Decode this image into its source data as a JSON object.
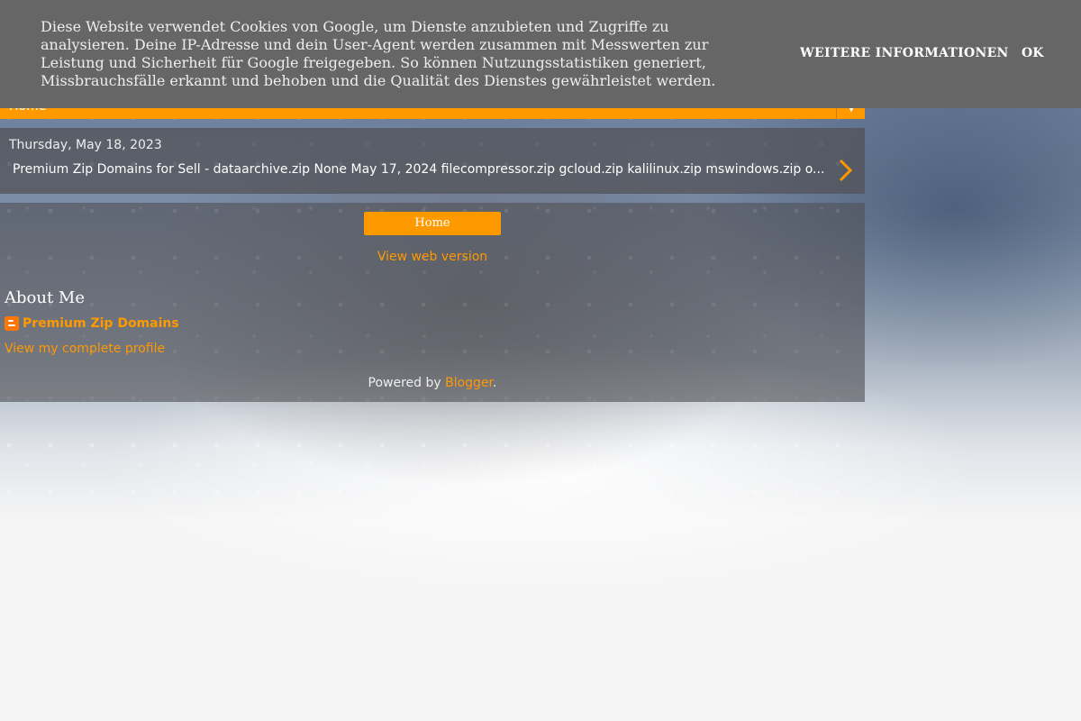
{
  "cookie_banner": {
    "text": "Diese Website verwendet Cookies von Google, um Dienste anzubieten und Zugriffe zu analysieren. Deine IP-Adresse und dein User-Agent werden zusammen mit Messwerten zur Leistung und Sicherheit für Google freigegeben. So können Nutzungsstatistiken generiert, Missbrauchsfälle erkannt und behoben und die Qualität des Dienstes gewährleistet werden.",
    "more_info_label": "WEITERE INFORMATIONEN",
    "ok_label": "OK"
  },
  "nav": {
    "selected": "Home",
    "arrow_icon": "triangle-down-icon"
  },
  "post": {
    "date": "Thursday, May 18, 2023",
    "snippet": "Premium Zip Domains for Sell - dataarchive.zip None May 17, 2024 filecompressor.zip gcloud.zip kalilinux.zip mswindows.zip o...",
    "arrow_icon": "chevron-right-icon"
  },
  "main": {
    "home_label": "Home",
    "web_version_label": "View web version"
  },
  "about": {
    "title": "About Me",
    "profile_name": "Premium Zip Domains",
    "profile_link": "View my complete profile",
    "profile_icon": "blogger-icon"
  },
  "footer": {
    "powered_prefix": "Powered by ",
    "powered_link": "Blogger",
    "powered_suffix": "."
  },
  "colors": {
    "accent": "#ff9900",
    "banner_bg": "#666666"
  }
}
